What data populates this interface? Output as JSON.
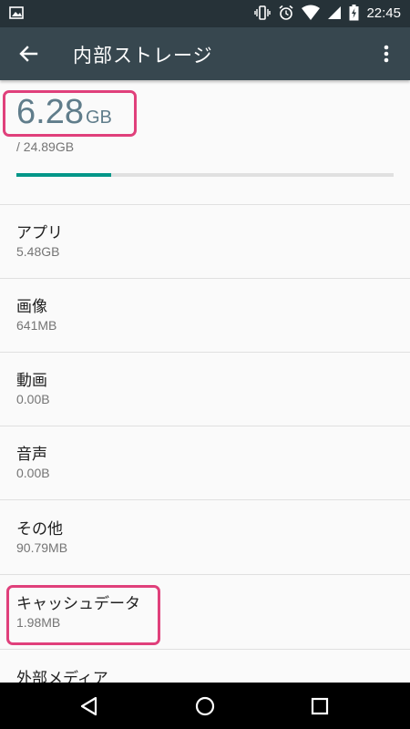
{
  "status_bar": {
    "time": "22:45",
    "icons": [
      "image-icon",
      "vibrate-icon",
      "alarm-icon",
      "wifi-icon",
      "signal-icon",
      "battery-charging-icon"
    ]
  },
  "app_bar": {
    "title": "内部ストレージ",
    "back_icon": "arrow-back-icon",
    "menu_icon": "more-vert-icon"
  },
  "summary": {
    "used_value": "6.28",
    "used_unit": "GB",
    "total": "/ 24.89GB",
    "used_fraction": 0.252
  },
  "items": [
    {
      "title": "アプリ",
      "size": "5.48GB"
    },
    {
      "title": "画像",
      "size": "641MB"
    },
    {
      "title": "動画",
      "size": "0.00B"
    },
    {
      "title": "音声",
      "size": "0.00B"
    },
    {
      "title": "その他",
      "size": "90.79MB"
    },
    {
      "title": "キャッシュデータ",
      "size": "1.98MB"
    },
    {
      "title": "外部メディア",
      "size": ""
    }
  ],
  "nav_bar": {
    "icons": [
      "back-triangle-icon",
      "home-circle-icon",
      "recents-square-icon"
    ]
  },
  "colors": {
    "status_bar": "#263238",
    "app_bar": "#37474f",
    "accent": "#009688",
    "highlight": "#e0407b",
    "used_text": "#607d8b"
  }
}
